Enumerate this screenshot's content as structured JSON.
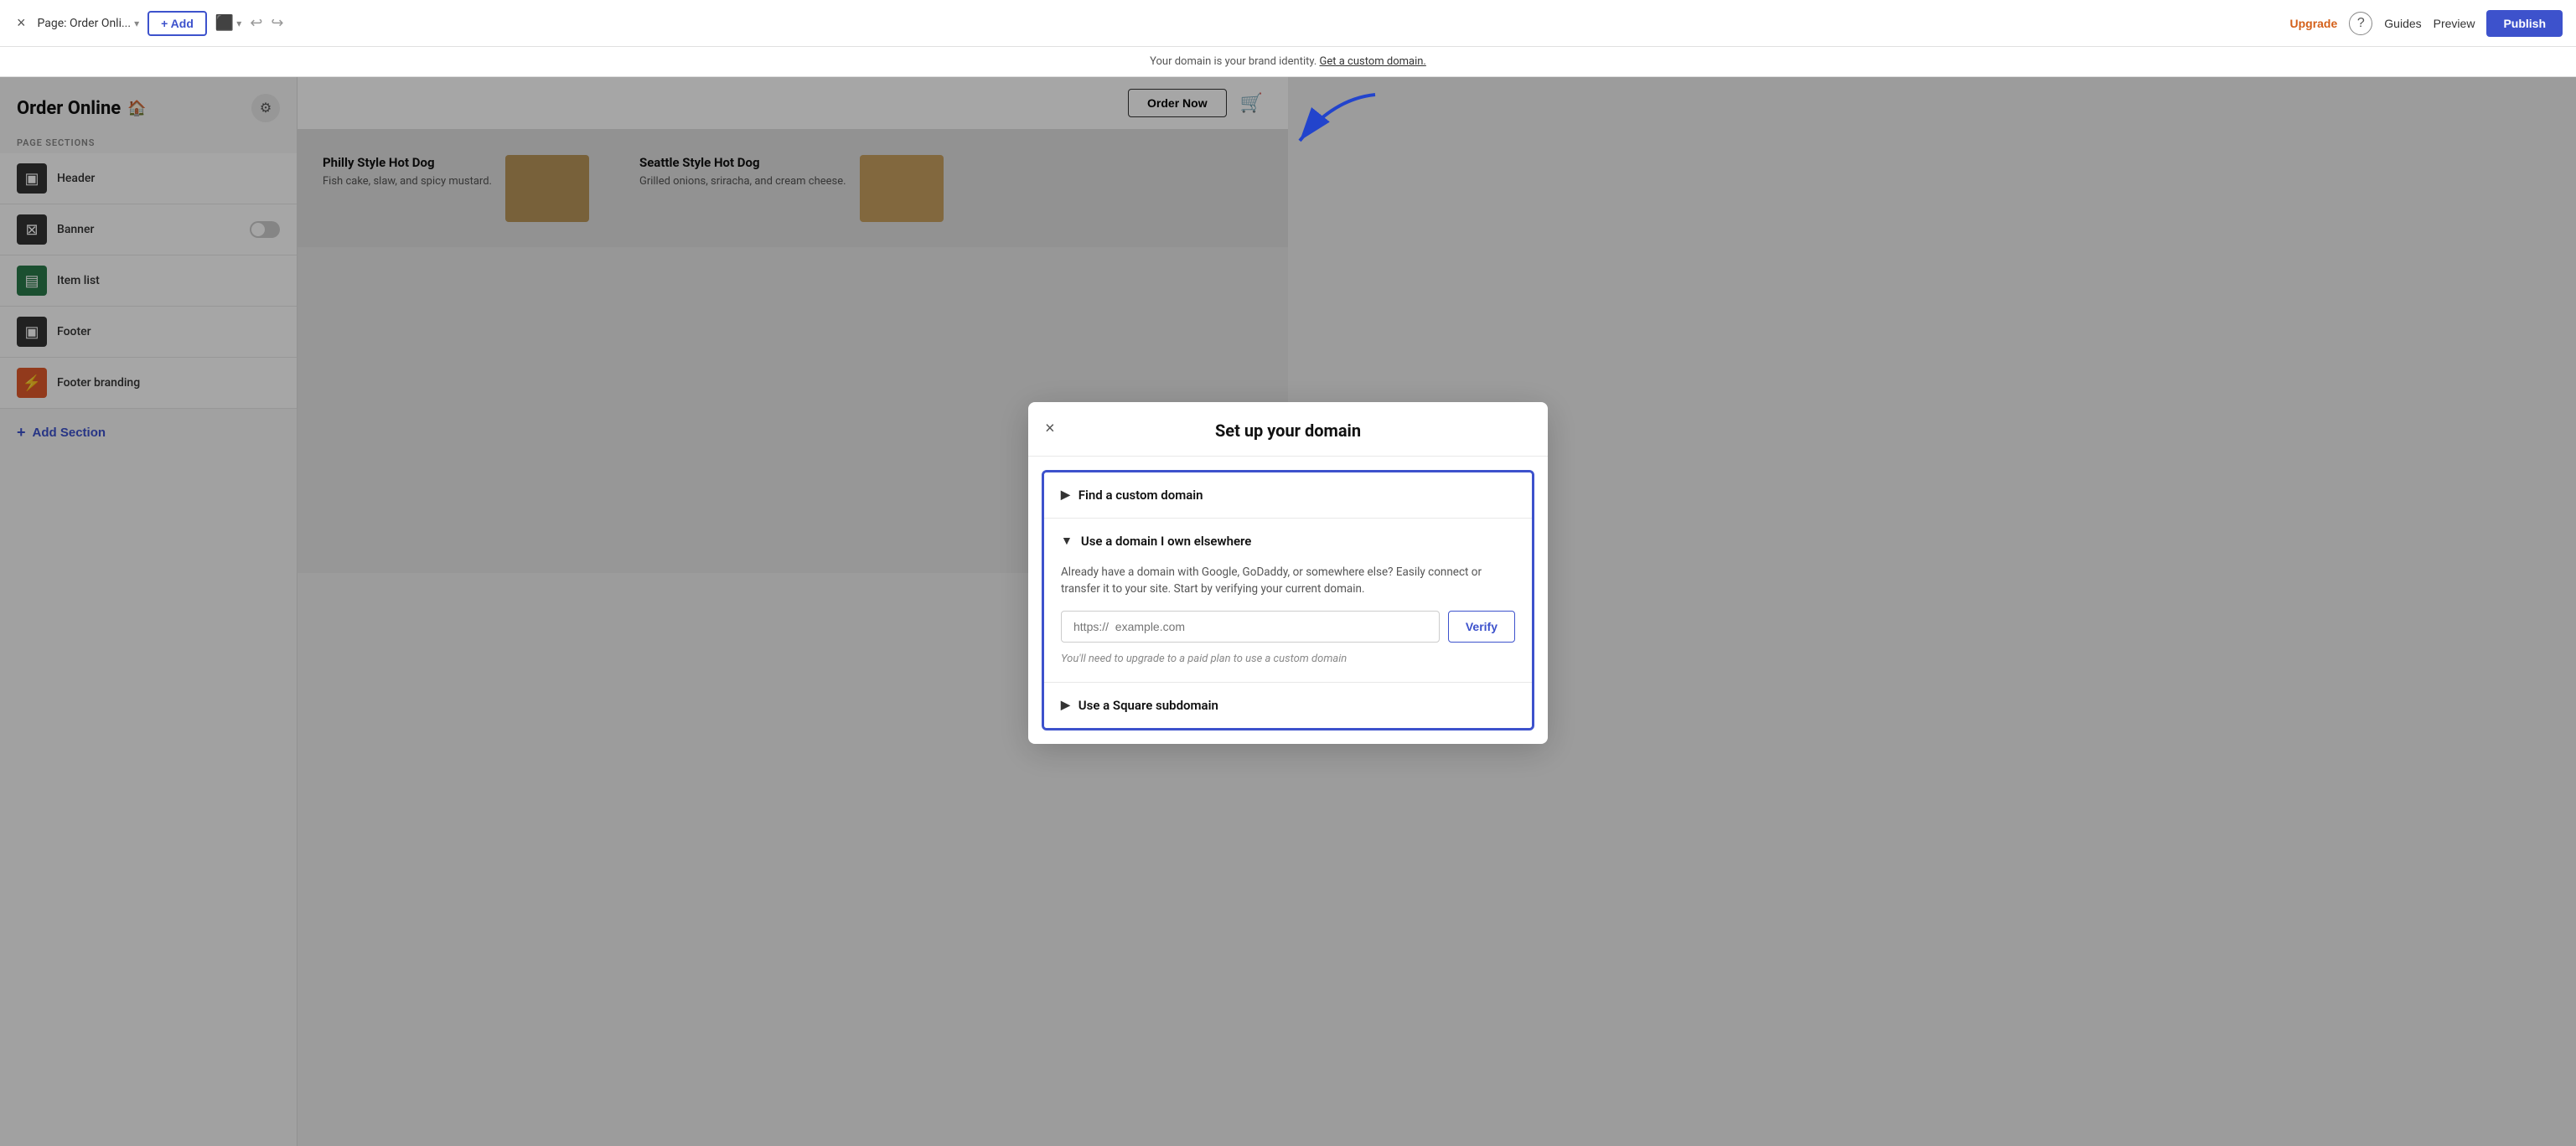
{
  "topbar": {
    "close_label": "×",
    "page_label": "Page: Order Onli...",
    "page_dropdown_icon": "▾",
    "add_label": "+ Add",
    "monitor_icon": "⬛",
    "monitor_dropdown": "▾",
    "undo_icon": "↩",
    "redo_icon": "↪",
    "upgrade_label": "Upgrade",
    "help_icon": "?",
    "guides_label": "Guides",
    "preview_label": "Preview",
    "publish_label": "Publish"
  },
  "domain_banner": {
    "text": "Your domain is your brand identity.",
    "link_text": "Get a custom domain."
  },
  "sidebar": {
    "title": "Order Online",
    "home_icon": "🏠",
    "sections_label": "PAGE SECTIONS",
    "sections": [
      {
        "id": "header",
        "name": "Header",
        "icon_type": "header",
        "icon": "▣",
        "has_toggle": false
      },
      {
        "id": "banner",
        "name": "Banner",
        "icon_type": "banner",
        "icon": "⊠",
        "has_toggle": true
      },
      {
        "id": "itemlist",
        "name": "Item list",
        "icon_type": "itemlist",
        "icon": "▤",
        "has_toggle": false
      },
      {
        "id": "footer",
        "name": "Footer",
        "icon_type": "footer",
        "icon": "▣",
        "has_toggle": false
      },
      {
        "id": "footerbrand",
        "name": "Footer branding",
        "icon_type": "footerbrand",
        "icon": "⚡",
        "has_toggle": false
      }
    ],
    "add_section_label": "Add Section"
  },
  "modal": {
    "close_icon": "×",
    "title": "Set up your domain",
    "accordion_items": [
      {
        "id": "find-custom",
        "icon": "▶",
        "label": "Find a custom domain",
        "expanded": false
      },
      {
        "id": "own-elsewhere",
        "icon": "▼",
        "label": "Use a domain I own elsewhere",
        "expanded": true,
        "description": "Already have a domain with Google, GoDaddy, or somewhere else? Easily connect or transfer it to your site. Start by verifying your current domain.",
        "input_placeholder": "https://  example.com",
        "verify_label": "Verify",
        "upgrade_notice": "You'll need to upgrade to a paid plan to use a custom domain"
      },
      {
        "id": "subdomain",
        "icon": "▶",
        "label": "Use a Square subdomain",
        "expanded": false
      }
    ]
  },
  "canvas": {
    "order_now_label": "Order Now",
    "cart_icon": "🛒",
    "food_items": [
      {
        "name": "Philly Style Hot Dog",
        "description": "Fish cake, slaw, and spicy mustard."
      },
      {
        "name": "Seattle Style Hot Dog",
        "description": "Grilled onions, sriracha, and cream cheese."
      }
    ]
  }
}
